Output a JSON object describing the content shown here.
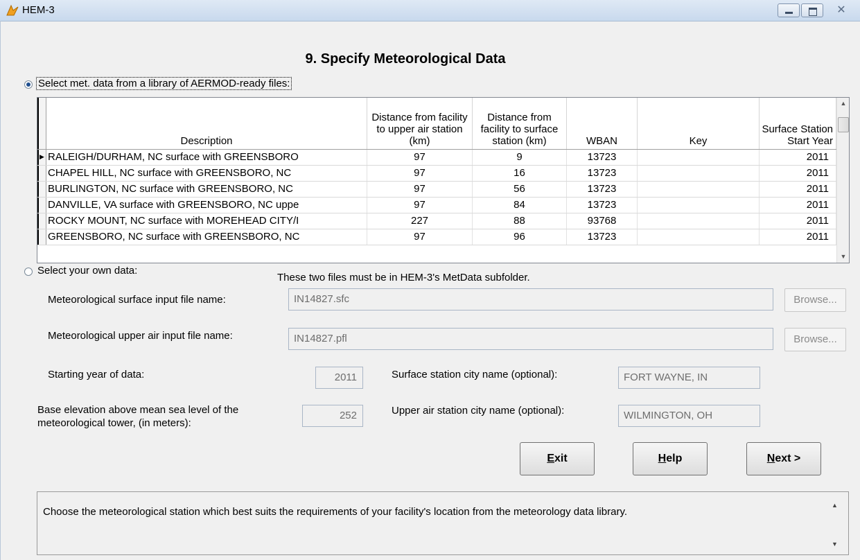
{
  "window": {
    "title": "HEM-3"
  },
  "page": {
    "heading": "9.  Specify Meteorological Data"
  },
  "library_option": {
    "label": "Select met. data from a library of AERMOD-ready files:",
    "selected": true
  },
  "grid": {
    "columns": [
      {
        "label": "Description"
      },
      {
        "label": "Distance from facility to upper air station (km)"
      },
      {
        "label": "Distance from facility to surface station (km)"
      },
      {
        "label": "WBAN"
      },
      {
        "label": "Key"
      },
      {
        "label": "Surface Station Start Year"
      }
    ],
    "rows": [
      {
        "description": "RALEIGH/DURHAM, NC surface with GREENSBORO",
        "upper": "97",
        "surface": "9",
        "wban": "13723",
        "key": "",
        "year": "2011"
      },
      {
        "description": "CHAPEL HILL, NC surface with GREENSBORO, NC",
        "upper": "97",
        "surface": "16",
        "wban": "13723",
        "key": "",
        "year": "2011"
      },
      {
        "description": "BURLINGTON, NC surface with GREENSBORO, NC",
        "upper": "97",
        "surface": "56",
        "wban": "13723",
        "key": "",
        "year": "2011"
      },
      {
        "description": "DANVILLE, VA surface with GREENSBORO, NC uppe",
        "upper": "97",
        "surface": "84",
        "wban": "13723",
        "key": "",
        "year": "2011"
      },
      {
        "description": "ROCKY MOUNT, NC surface with MOREHEAD CITY/I",
        "upper": "227",
        "surface": "88",
        "wban": "93768",
        "key": "",
        "year": "2011"
      },
      {
        "description": "GREENSBORO, NC surface with GREENSBORO, NC",
        "upper": "97",
        "surface": "96",
        "wban": "13723",
        "key": "",
        "year": "2011"
      }
    ]
  },
  "own_option": {
    "label": "Select your own data:",
    "selected": false
  },
  "note": "These two files must be in HEM-3's MetData subfolder.",
  "surface_file": {
    "label": "Meteorological surface input file name:",
    "value": "IN14827.sfc",
    "browse": "Browse..."
  },
  "upper_file": {
    "label": "Meteorological upper air input file name:",
    "value": "IN14827.pfl",
    "browse": "Browse..."
  },
  "start_year": {
    "label": "Starting year of data:",
    "value": "2011"
  },
  "surface_city": {
    "label": "Surface station city name (optional):",
    "value": "FORT WAYNE, IN"
  },
  "elevation": {
    "label_line1": "Base elevation above mean sea level of the",
    "label_line2": "meteorological tower, (in meters):",
    "value": "252"
  },
  "upper_city": {
    "label": "Upper air station city name (optional):",
    "value": "WILMINGTON, OH"
  },
  "buttons": {
    "exit_mnemonic": "E",
    "exit_rest": "xit",
    "help_mnemonic": "H",
    "help_rest": "elp",
    "next_mnemonic": "N",
    "next_rest": "ext >"
  },
  "message": "Choose the meteorological station which best suits the requirements of your facility's location from the meteorology data library.",
  "icons": {
    "app": "hem-app-icon",
    "minimize": "minimize-icon",
    "maximize": "maximize-icon",
    "close": "close-icon"
  }
}
